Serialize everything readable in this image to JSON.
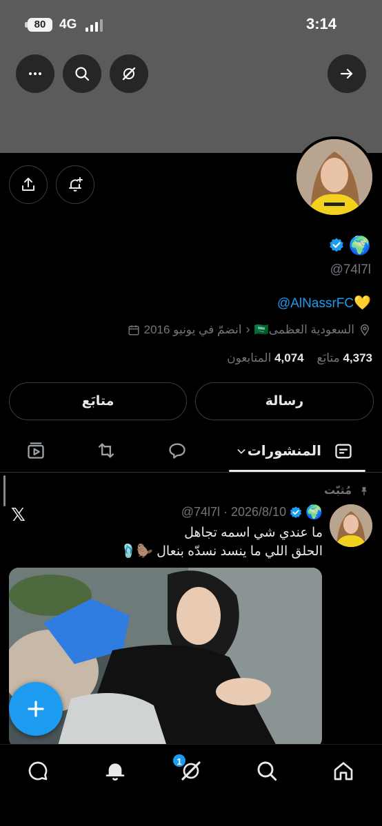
{
  "status_bar": {
    "battery": "80",
    "network": "4G",
    "time": "3:14"
  },
  "profile": {
    "name_emoji": "🌍",
    "handle": "@74l7l",
    "bio_mention": "@AlNassrFC",
    "bio_heart": "💛",
    "location": "السعودية العظمى🇸🇦",
    "joined": "انضمّ في يونيو 2016",
    "following_count": "4,373",
    "following_label": "متابَع",
    "followers_count": "4,074",
    "followers_label": "المتابعون"
  },
  "buttons": {
    "message": "رسالة",
    "follow": "متابَع"
  },
  "tabs": {
    "posts": "المنشورات"
  },
  "post": {
    "pinned_label": "مُثبّت",
    "emoji": "🌍",
    "handle_date": "@74l7l · 2026/8/10",
    "line1": "ما عندي شي اسمه تجاهل",
    "line2": "الحلق اللي ما ينسد نسدّه بنعال 🦫🩴"
  },
  "bottom_nav": {
    "notif_badge": "1"
  },
  "colors": {
    "accent": "#1d9bf0",
    "banner": "#5b5b5b",
    "muted": "#71767b"
  }
}
